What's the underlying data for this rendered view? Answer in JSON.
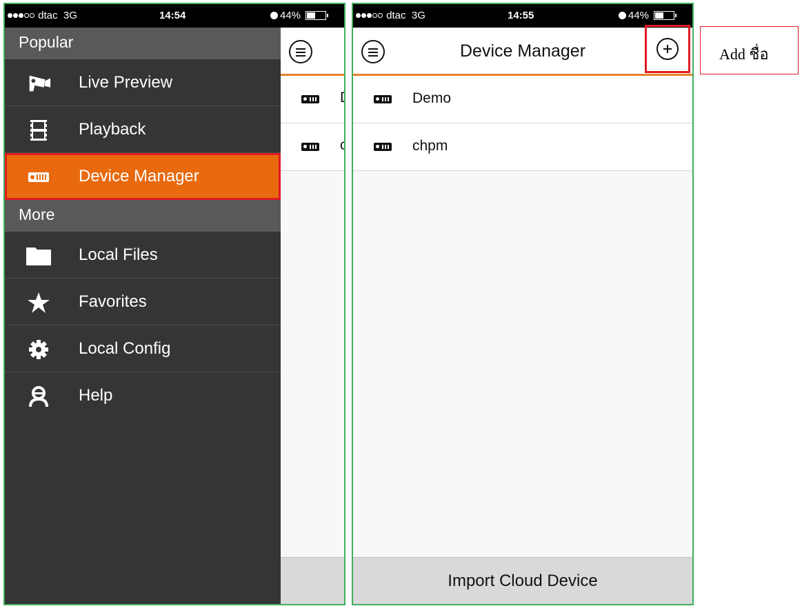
{
  "left_phone": {
    "statusbar": {
      "carrier": "dtac",
      "network": "3G",
      "time": "14:54",
      "battery": "44%"
    },
    "menu": {
      "popular_header": "Popular",
      "popular_items": [
        {
          "label": "Live Preview",
          "icon": "camera-icon"
        },
        {
          "label": "Playback",
          "icon": "film-icon"
        },
        {
          "label": "Device Manager",
          "icon": "device-icon",
          "active": true
        }
      ],
      "more_header": "More",
      "more_items": [
        {
          "label": "Local Files",
          "icon": "folder-icon"
        },
        {
          "label": "Favorites",
          "icon": "star-icon"
        },
        {
          "label": "Local Config",
          "icon": "gear-icon"
        },
        {
          "label": "Help",
          "icon": "person-icon"
        }
      ]
    },
    "peek_rows": [
      "D",
      "c"
    ]
  },
  "right_phone": {
    "statusbar": {
      "carrier": "dtac",
      "network": "3G",
      "time": "14:55",
      "battery": "44%"
    },
    "title": "Device Manager",
    "devices": [
      "Demo",
      "chpm"
    ],
    "footer_button": "Import Cloud Device"
  },
  "annotation": {
    "text": "Add ชื่อ"
  },
  "colors": {
    "accent": "#e8690e",
    "highlight": "#e01b22",
    "frame": "#3fae5c",
    "menu_bg": "#353535",
    "section_bg": "#595959"
  }
}
